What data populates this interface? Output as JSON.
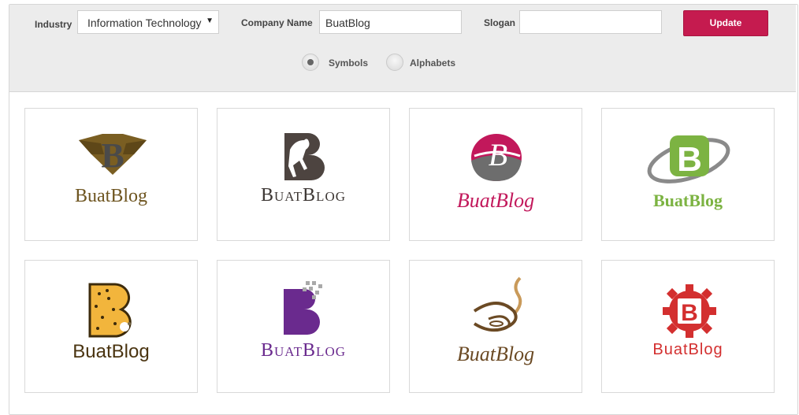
{
  "form": {
    "industry_label": "Industry",
    "industry_value": "Information Technology",
    "company_label": "Company Name",
    "company_value": "BuatBlog",
    "slogan_label": "Slogan",
    "slogan_value": "",
    "update_label": "Update"
  },
  "options": {
    "selected": "Symbols",
    "items": [
      "Symbols",
      "Alphabets"
    ]
  },
  "logos": [
    {
      "text": "BuatBlog",
      "color": "#6e5520",
      "icon": "diamond-b-icon"
    },
    {
      "text": "BuatBlog",
      "color": "#4d4440",
      "icon": "horse-b-icon"
    },
    {
      "text": "BuatBlog",
      "color": "#c2185b",
      "icon": "globe-b-icon"
    },
    {
      "text": "BuatBlog",
      "color": "#7cb342",
      "icon": "orbit-b-icon"
    },
    {
      "text": "BuatBlog",
      "color": "#4a3410",
      "icon": "cookie-b-icon"
    },
    {
      "text": "BuatBlog",
      "color": "#6a2a8e",
      "icon": "pixel-b-icon"
    },
    {
      "text": "BuatBlog",
      "color": "#6b4a24",
      "icon": "coffee-b-icon"
    },
    {
      "text": "BuatBlog",
      "color": "#d32f2f",
      "icon": "gear-b-icon"
    }
  ]
}
